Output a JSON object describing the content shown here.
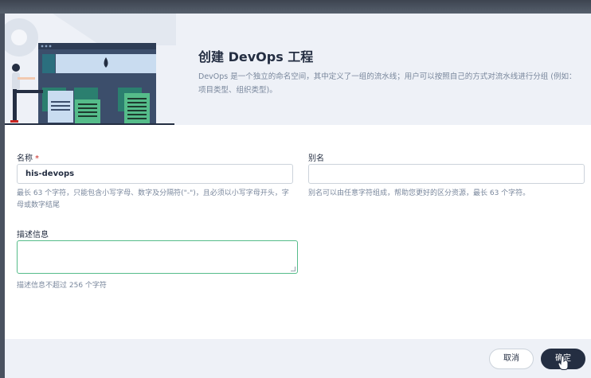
{
  "dialog": {
    "title": "创建 DevOps 工程",
    "description": "DevOps 是一个独立的命名空间，其中定义了一组的流水线；用户可以按照自己的方式对流水线进行分组 (例如：项目类型、组织类型)。"
  },
  "form": {
    "name": {
      "label": "名称",
      "required_mark": "*",
      "value": "his-devops",
      "hint_line1": "最长 63 个字符，只能包含小写字母、数字及分隔符(\"-\")，且必须以小写字母开头，字",
      "hint_line2": "母或数字结尾"
    },
    "alias": {
      "label": "别名",
      "value": "",
      "hint": "别名可以由任意字符组成，帮助您更好的区分资源，最长 63 个字符。"
    },
    "description": {
      "label": "描述信息",
      "value": "",
      "hint": "描述信息不超过 256 个字符"
    }
  },
  "footer": {
    "cancel_label": "取消",
    "ok_label": "确定"
  },
  "colors": {
    "primary_dark": "#242e42",
    "accent_green": "#55bc8a",
    "required_red": "#ca2621",
    "header_bg": "#eef1f7"
  }
}
